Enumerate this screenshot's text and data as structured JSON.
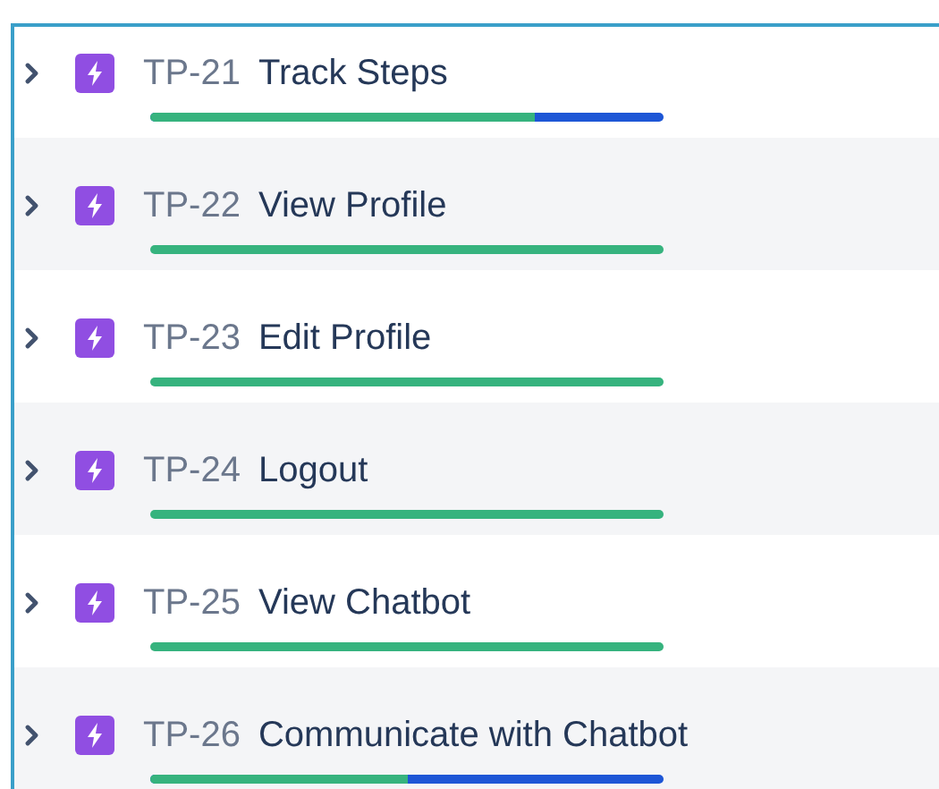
{
  "issues": [
    {
      "key": "TP-21",
      "title": "Track Steps",
      "level": 0.75
    },
    {
      "key": "TP-22",
      "title": "View Profile",
      "level": 1
    },
    {
      "key": "TP-23",
      "title": "Edit Profile",
      "level": 1
    },
    {
      "key": "TP-24",
      "title": "Logout",
      "level": 1
    },
    {
      "key": "TP-25",
      "title": "View Chatbot",
      "level": 1
    },
    {
      "key": "TP-26",
      "title": "Communicate with Chatbot",
      "level": 0.5
    }
  ]
}
